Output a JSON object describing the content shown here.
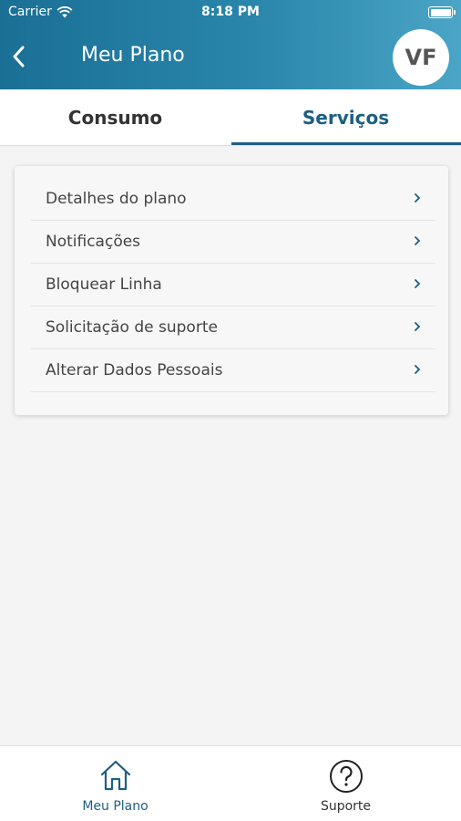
{
  "status_bar": {
    "carrier": "Carrier",
    "time": "8:18 PM"
  },
  "header": {
    "title": "Meu Plano",
    "avatar_initials": "VF"
  },
  "tabs": [
    {
      "label": "Consumo",
      "active": false
    },
    {
      "label": "Serviços",
      "active": true
    }
  ],
  "menu": {
    "items": [
      {
        "label": "Detalhes do plano"
      },
      {
        "label": "Notificações"
      },
      {
        "label": "Bloquear Linha"
      },
      {
        "label": "Solicitação de suporte"
      },
      {
        "label": "Alterar Dados Pessoais"
      }
    ]
  },
  "bottom_nav": {
    "items": [
      {
        "label": "Meu Plano",
        "icon": "home-icon",
        "active": true
      },
      {
        "label": "Suporte",
        "icon": "question-circle-icon",
        "active": false
      }
    ]
  },
  "colors": {
    "header_gradient_start": "#1a6f95",
    "header_gradient_end": "#4aa5c6",
    "accent": "#1d5f83"
  }
}
